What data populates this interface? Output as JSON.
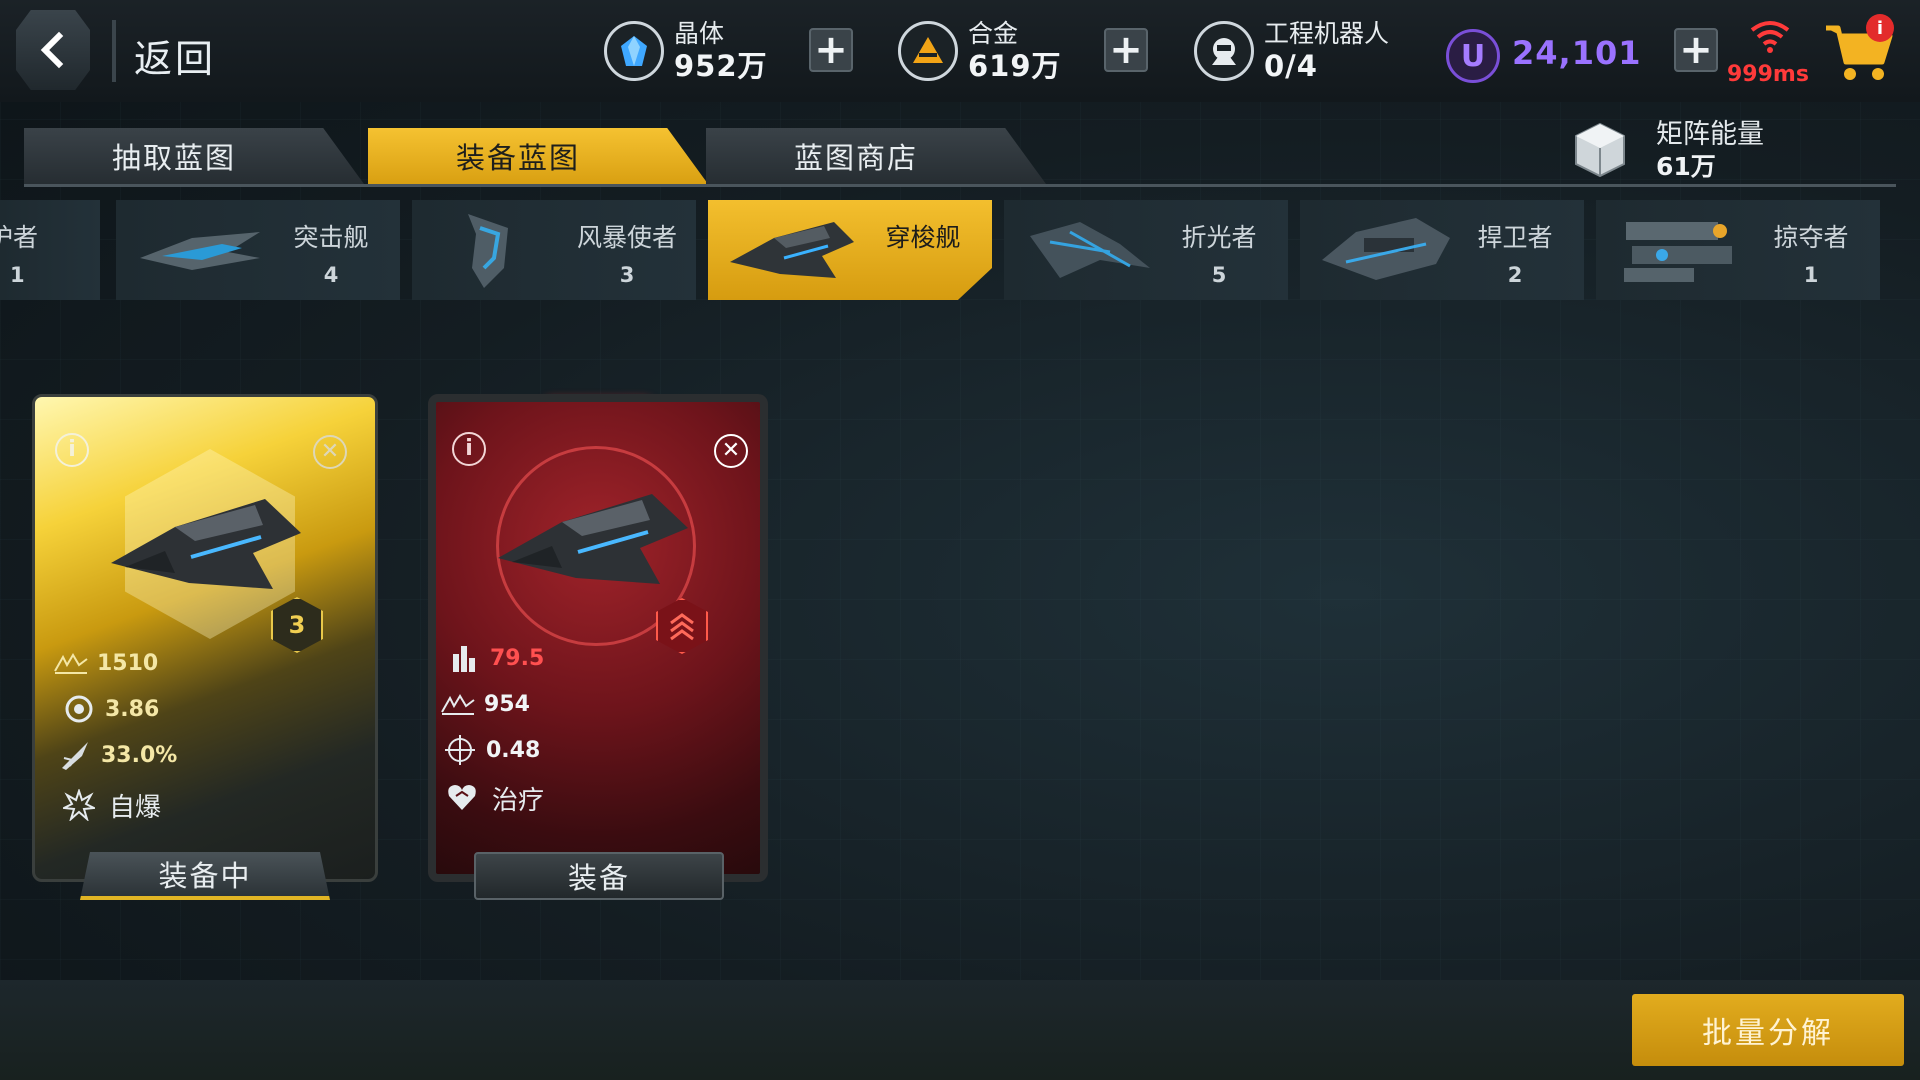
{
  "header": {
    "back_label": "返回",
    "resources": [
      {
        "name": "晶体",
        "value": "952万",
        "icon": "crystal-icon"
      },
      {
        "name": "合金",
        "value": "619万",
        "icon": "alloy-icon"
      },
      {
        "name": "工程机器人",
        "value": "0/4",
        "icon": "robot-icon"
      }
    ],
    "ucoin": {
      "symbol": "U",
      "value": "24,101"
    },
    "ping": "999ms",
    "cart_badge": "i",
    "plus_symbol": "+"
  },
  "tabs": [
    {
      "label": "抽取蓝图",
      "active": false
    },
    {
      "label": "装备蓝图",
      "active": true
    },
    {
      "label": "蓝图商店",
      "active": false
    }
  ],
  "matrix_energy": {
    "label": "矩阵能量",
    "value": "61万"
  },
  "categories": {
    "partial": {
      "name": "护者",
      "count": "1"
    },
    "items": [
      {
        "name": "突击舰",
        "count": "4",
        "active": false
      },
      {
        "name": "风暴使者",
        "count": "3",
        "active": false
      },
      {
        "name": "穿梭舰",
        "count": "",
        "active": true
      },
      {
        "name": "折光者",
        "count": "5",
        "active": false
      },
      {
        "name": "捍卫者",
        "count": "2",
        "active": false
      },
      {
        "name": "掠夺者",
        "count": "1",
        "active": false
      }
    ]
  },
  "cards": [
    {
      "rank": "3",
      "stats": [
        {
          "icon": "hp-icon",
          "value": "1510"
        },
        {
          "icon": "speed-icon",
          "value": "3.86"
        },
        {
          "icon": "crit-icon",
          "value": "33.0%"
        }
      ],
      "skill": {
        "icon": "explode-icon",
        "label": "自爆"
      },
      "button": "装备中"
    },
    {
      "stats": [
        {
          "icon": "damage-icon",
          "value": "79.5"
        },
        {
          "icon": "hp-icon",
          "value": "954"
        },
        {
          "icon": "accuracy-icon",
          "value": "0.48"
        }
      ],
      "skill": {
        "icon": "heal-icon",
        "label": "治疗"
      },
      "button": "装备"
    }
  ],
  "batch_button": "批量分解",
  "colors": {
    "accent_yellow": "#f3bf2e",
    "red_card": "#a0232a",
    "ucoin_purple": "#9a72ff",
    "ping_red": "#ff3a3a"
  }
}
